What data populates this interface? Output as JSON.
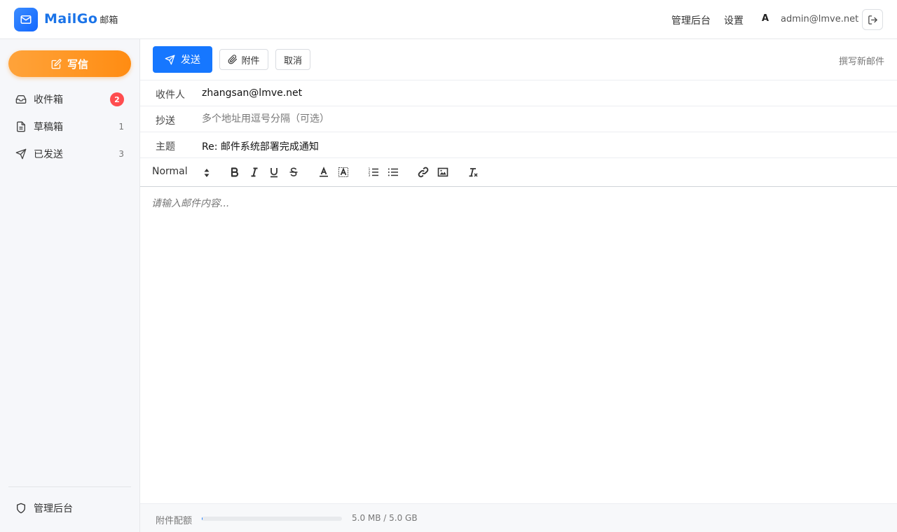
{
  "header": {
    "brand_name": "MailGo",
    "brand_sub": "邮箱",
    "admin_link": "管理后台",
    "settings_link": "设置",
    "avatar_letter": "A",
    "user_email": "admin@lmve.net"
  },
  "sidebar": {
    "compose_label": "写信",
    "items": [
      {
        "label": "收件箱",
        "count": "2",
        "icon": "inbox-icon",
        "badge": true
      },
      {
        "label": "草稿箱",
        "count": "1",
        "icon": "draft-icon",
        "badge": false
      },
      {
        "label": "已发送",
        "count": "3",
        "icon": "send-icon",
        "badge": false
      }
    ],
    "admin_label": "管理后台"
  },
  "toolbar": {
    "send_label": "发送",
    "attach_label": "附件",
    "cancel_label": "取消",
    "compose_title": "撰写新邮件"
  },
  "fields": {
    "to_label": "收件人",
    "to_value": "zhangsan@lmve.net",
    "cc_label": "抄送",
    "cc_placeholder": "多个地址用逗号分隔（可选）",
    "subject_label": "主题",
    "subject_value": "Re: 邮件系统部署完成通知"
  },
  "editor": {
    "format_value": "Normal",
    "placeholder": "请输入邮件内容..."
  },
  "footer": {
    "quota_label": "附件配额",
    "quota_text": "5.0 MB / 5.0 GB",
    "quota_fraction": 0.001
  },
  "colors": {
    "accent": "#1677ff",
    "compose": "#ff8c12",
    "badge": "#ff4d4f"
  }
}
